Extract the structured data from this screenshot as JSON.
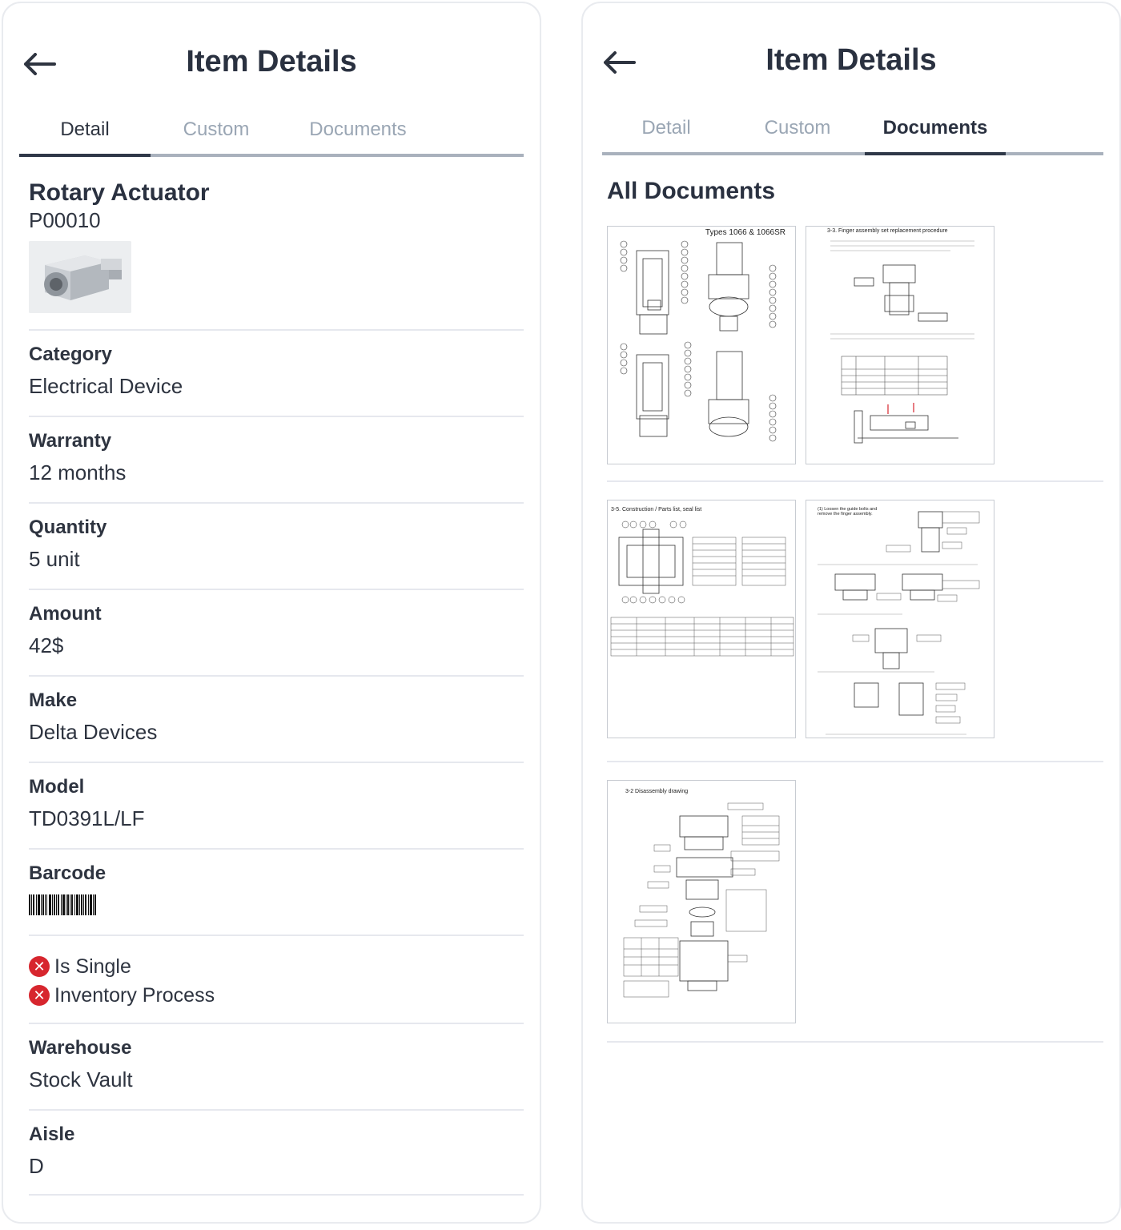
{
  "left": {
    "title": "Item Details",
    "tabs": [
      "Detail",
      "Custom",
      "Documents"
    ],
    "item": {
      "name": "Rotary Actuator",
      "code": "P00010"
    },
    "fields": [
      {
        "label": "Category",
        "value": "Electrical Device"
      },
      {
        "label": "Warranty",
        "value": "12 months"
      },
      {
        "label": "Quantity",
        "value": "5 unit"
      },
      {
        "label": "Amount",
        "value": "42$"
      },
      {
        "label": "Make",
        "value": "Delta Devices"
      },
      {
        "label": "Model",
        "value": "TD0391L/LF"
      }
    ],
    "barcode_label": "Barcode",
    "flags": [
      "Is Single",
      "Inventory Process"
    ],
    "fields2": [
      {
        "label": "Warehouse",
        "value": "Stock Vault"
      },
      {
        "label": "Aisle",
        "value": "D"
      }
    ]
  },
  "right": {
    "title": "Item Details",
    "tabs": [
      "Detail",
      "Custom",
      "Documents"
    ],
    "section_title": "All Documents",
    "documents": [
      {
        "caption": "Types 1066 & 1066SR"
      },
      {
        "caption": "3-3. Finger assembly set replacement procedure"
      },
      {
        "caption": "3-5. Construction / Parts list, seal list"
      },
      {
        "caption": "(1) Loosen the guide bolts and remove the finger assembly."
      },
      {
        "caption": "3-2 Disassembly drawing"
      }
    ]
  },
  "colors": {
    "accent": "#2f3848",
    "error": "#d7262e",
    "muted_tab": "#9aa6b4"
  }
}
